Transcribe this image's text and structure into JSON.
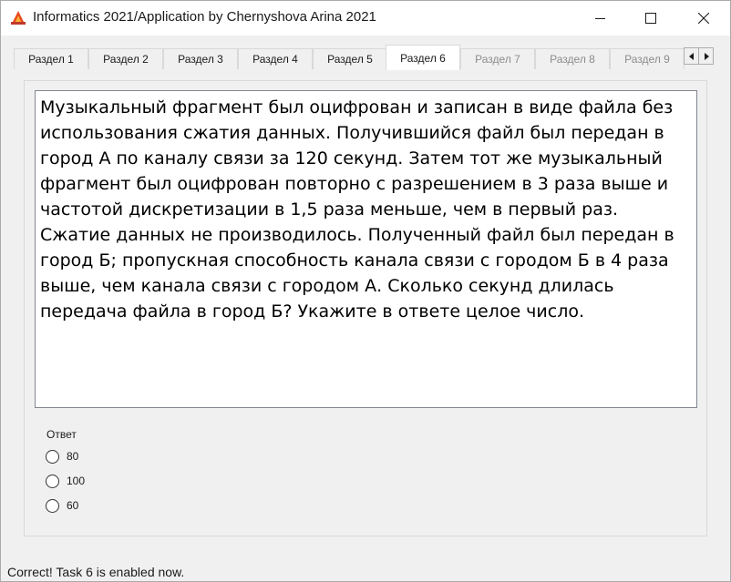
{
  "window": {
    "title": "Informatics 2021/Application by Chernyshova Arina 2021",
    "icon": "flame-app-icon",
    "controls": [
      "minimize-icon",
      "maximize-icon",
      "close-icon"
    ]
  },
  "tabs": [
    {
      "label": "Раздел 1",
      "state": "enabled"
    },
    {
      "label": "Раздел 2",
      "state": "enabled"
    },
    {
      "label": "Раздел 3",
      "state": "enabled"
    },
    {
      "label": "Раздел 4",
      "state": "enabled"
    },
    {
      "label": "Раздел 5",
      "state": "enabled"
    },
    {
      "label": "Раздел 6",
      "state": "active"
    },
    {
      "label": "Раздел 7",
      "state": "disabled"
    },
    {
      "label": "Раздел 8",
      "state": "disabled"
    },
    {
      "label": "Раздел 9",
      "state": "disabled"
    }
  ],
  "question": {
    "text": "Музыкальный фрагмент был оцифрован и записан в виде файла без использования сжатия данных. Получившийся файл был передан в город А по каналу связи за 120 секунд. Затем тот же музыкальный фрагмент был оцифрован повторно с разрешением в 3 раза выше и частотой дискретизации в 1,5 раза меньше, чем в первый раз. Сжатие данных не производилось. Полученный файл был передан в город Б; пропускная способность канала связи с городом Б в 4 раза выше, чем канала связи с городом А. Сколько секунд длилась передача файла в город Б? Укажите в ответе целое число."
  },
  "answer": {
    "label": "Ответ",
    "options": [
      "80",
      "100",
      "60"
    ]
  },
  "status": {
    "text": "Correct! Task 6 is enabled now."
  },
  "colors": {
    "window_bg": "#f0f0f0",
    "active_tab": "#ffffff",
    "disabled_text": "#8c8c8c"
  }
}
